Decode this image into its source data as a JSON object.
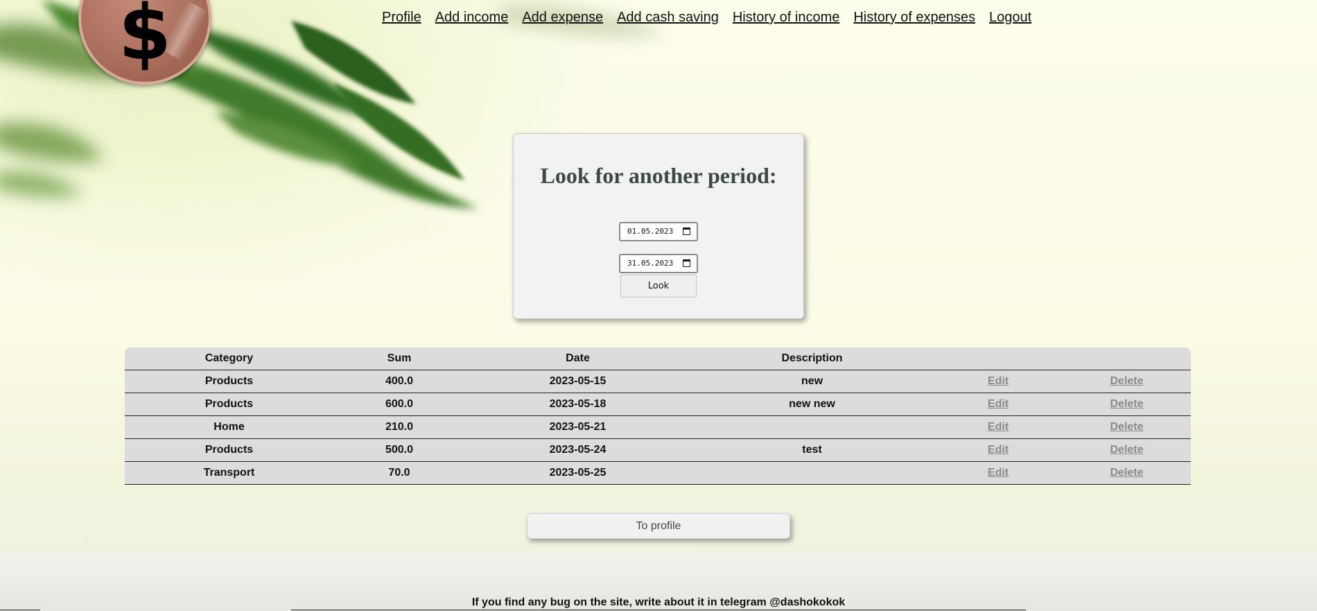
{
  "nav": {
    "items": [
      {
        "label": "Profile"
      },
      {
        "label": "Add income"
      },
      {
        "label": "Add expense"
      },
      {
        "label": "Add cash saving"
      },
      {
        "label": "History of income"
      },
      {
        "label": "History of expenses"
      },
      {
        "label": "Logout"
      }
    ]
  },
  "logo": {
    "icon": "dollar-icon",
    "glyph": "$",
    "color": "#a86d5a"
  },
  "search": {
    "title": "Look for another period:",
    "start_date": "01.05.2023",
    "end_date": "31.05.2023",
    "button_label": "Look"
  },
  "table": {
    "headers": [
      "Category",
      "Sum",
      "Date",
      "Description",
      "",
      ""
    ],
    "rows": [
      {
        "category": "Products",
        "sum": "400.0",
        "date": "2023-05-15",
        "description": "new",
        "edit": "Edit",
        "delete": "Delete"
      },
      {
        "category": "Products",
        "sum": "600.0",
        "date": "2023-05-18",
        "description": "new new",
        "edit": "Edit",
        "delete": "Delete"
      },
      {
        "category": "Home",
        "sum": "210.0",
        "date": "2023-05-21",
        "description": "",
        "edit": "Edit",
        "delete": "Delete"
      },
      {
        "category": "Products",
        "sum": "500.0",
        "date": "2023-05-24",
        "description": "test",
        "edit": "Edit",
        "delete": "Delete"
      },
      {
        "category": "Transport",
        "sum": "70.0",
        "date": "2023-05-25",
        "description": "",
        "edit": "Edit",
        "delete": "Delete"
      }
    ]
  },
  "to_profile_label": "To profile",
  "footer_text": "If you find any bug on the site, write about it in telegram @dashokokok"
}
